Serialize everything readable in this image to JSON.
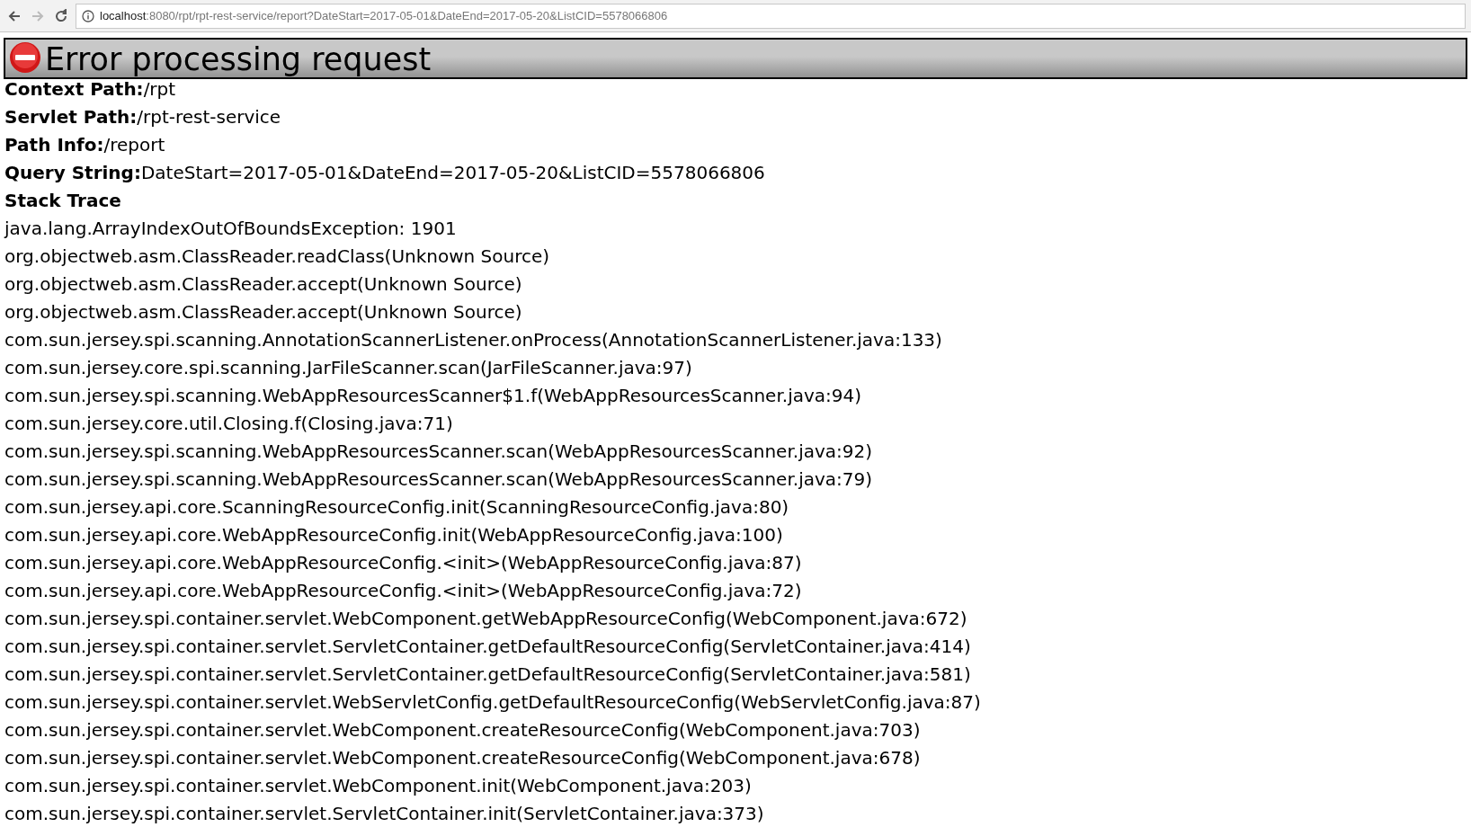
{
  "browser": {
    "url_host": "localhost",
    "url_rest": ":8080/rpt/rpt-rest-service/report?DateStart=2017-05-01&DateEnd=2017-05-20&ListCID=5578066806",
    "back_disabled": false,
    "forward_disabled": true
  },
  "header": {
    "title": "Error processing request"
  },
  "fields": [
    {
      "label": "Context Path:",
      "value": "/rpt"
    },
    {
      "label": "Servlet Path:",
      "value": "/rpt-rest-service"
    },
    {
      "label": "Path Info:",
      "value": "/report"
    },
    {
      "label": "Query String:",
      "value": "DateStart=2017-05-01&DateEnd=2017-05-20&ListCID=5578066806"
    }
  ],
  "stack_trace": {
    "heading": "Stack Trace",
    "lines": [
      "java.lang.ArrayIndexOutOfBoundsException: 1901",
      "org.objectweb.asm.ClassReader.readClass(Unknown Source)",
      "org.objectweb.asm.ClassReader.accept(Unknown Source)",
      "org.objectweb.asm.ClassReader.accept(Unknown Source)",
      "com.sun.jersey.spi.scanning.AnnotationScannerListener.onProcess(AnnotationScannerListener.java:133)",
      "com.sun.jersey.core.spi.scanning.JarFileScanner.scan(JarFileScanner.java:97)",
      "com.sun.jersey.spi.scanning.WebAppResourcesScanner$1.f(WebAppResourcesScanner.java:94)",
      "com.sun.jersey.core.util.Closing.f(Closing.java:71)",
      "com.sun.jersey.spi.scanning.WebAppResourcesScanner.scan(WebAppResourcesScanner.java:92)",
      "com.sun.jersey.spi.scanning.WebAppResourcesScanner.scan(WebAppResourcesScanner.java:79)",
      "com.sun.jersey.api.core.ScanningResourceConfig.init(ScanningResourceConfig.java:80)",
      "com.sun.jersey.api.core.WebAppResourceConfig.init(WebAppResourceConfig.java:100)",
      "com.sun.jersey.api.core.WebAppResourceConfig.<init>(WebAppResourceConfig.java:87)",
      "com.sun.jersey.api.core.WebAppResourceConfig.<init>(WebAppResourceConfig.java:72)",
      "com.sun.jersey.spi.container.servlet.WebComponent.getWebAppResourceConfig(WebComponent.java:672)",
      "com.sun.jersey.spi.container.servlet.ServletContainer.getDefaultResourceConfig(ServletContainer.java:414)",
      "com.sun.jersey.spi.container.servlet.ServletContainer.getDefaultResourceConfig(ServletContainer.java:581)",
      "com.sun.jersey.spi.container.servlet.WebServletConfig.getDefaultResourceConfig(WebServletConfig.java:87)",
      "com.sun.jersey.spi.container.servlet.WebComponent.createResourceConfig(WebComponent.java:703)",
      "com.sun.jersey.spi.container.servlet.WebComponent.createResourceConfig(WebComponent.java:678)",
      "com.sun.jersey.spi.container.servlet.WebComponent.init(WebComponent.java:203)",
      "com.sun.jersey.spi.container.servlet.ServletContainer.init(ServletContainer.java:373)"
    ]
  }
}
